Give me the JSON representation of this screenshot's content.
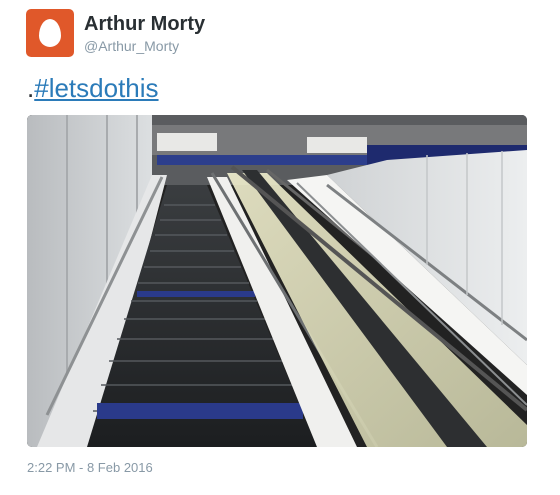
{
  "author": {
    "display_name": "Arthur Morty",
    "handle": "@Arthur_Morty",
    "avatar_icon": "default-egg-avatar-icon",
    "avatar_color": "#e0582a"
  },
  "tweet": {
    "prefix": ".",
    "hashtag": "#letsdothis",
    "timestamp": "2:22 PM - 8 Feb 2016"
  },
  "media": {
    "description_icon": "photo-staircase-escalator"
  },
  "colors": {
    "link": "#2b7bb9",
    "name": "#292f33",
    "muted": "#8899a6"
  }
}
